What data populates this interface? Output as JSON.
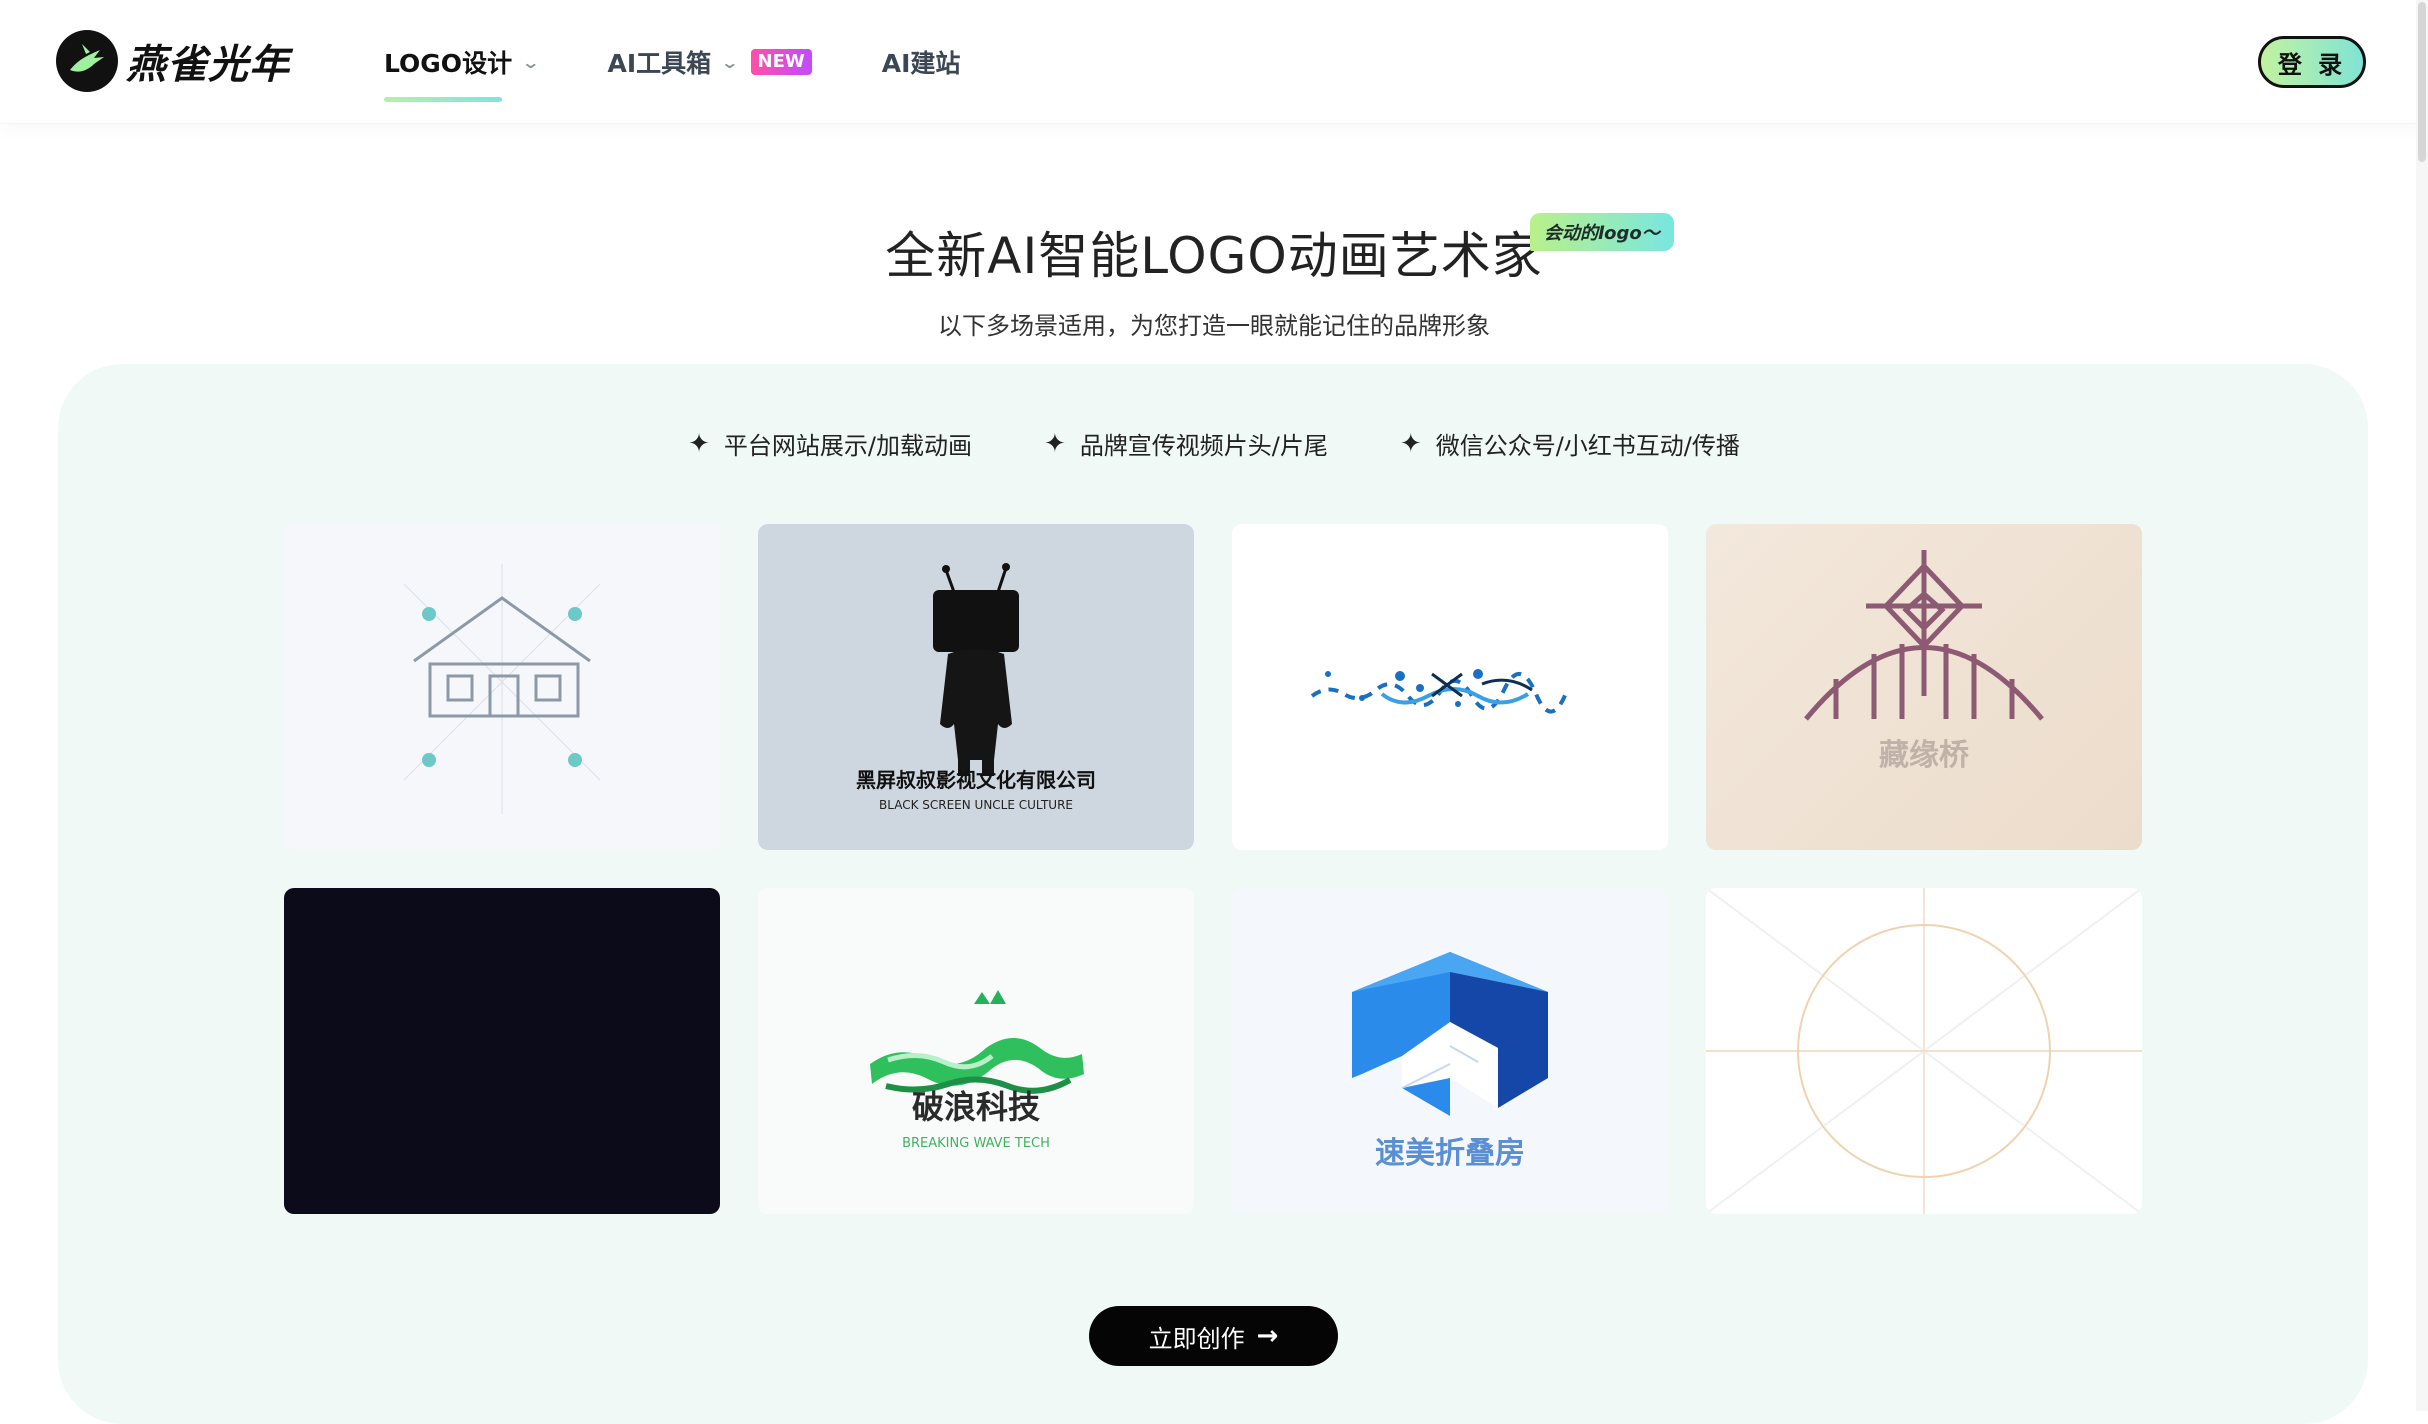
{
  "header": {
    "brand": "燕雀光年",
    "nav": [
      {
        "label": "LOGO设计",
        "active": true
      },
      {
        "label": "AI工具箱",
        "badge": "NEW"
      },
      {
        "label": "AI建站"
      }
    ],
    "login": "登 录"
  },
  "hero": {
    "title": "全新AI智能LOGO动画艺术家",
    "tag": "会动的logo～",
    "subtitle": "以下多场景适用，为您打造一眼就能记住的品牌形象"
  },
  "features": [
    {
      "label": "平台网站展示/加载动画"
    },
    {
      "label": "品牌宣传视频片头/片尾"
    },
    {
      "label": "微信公众号/小红书互动/传播"
    }
  ],
  "cards": [
    {
      "id": "house-sketch"
    },
    {
      "id": "tv-head",
      "title": "黑屏叔叔影视文化有限公司",
      "subtitle": "BLACK SCREEN UNCLE CULTURE"
    },
    {
      "id": "wave-dots"
    },
    {
      "id": "bridge",
      "title": "藏缘桥"
    },
    {
      "id": "dark"
    },
    {
      "id": "wave-tech",
      "title": "破浪科技",
      "subtitle": "BREAKING WAVE TECH"
    },
    {
      "id": "fold-house",
      "title": "速美折叠房"
    },
    {
      "id": "circle-guide"
    }
  ],
  "cta": "立即创作",
  "colors": {
    "accent_gradient_start": "#c2f2a0",
    "accent_gradient_end": "#7fe3d6",
    "panel_bg": "#f1f9f6",
    "new_badge": "#e04bd0"
  }
}
